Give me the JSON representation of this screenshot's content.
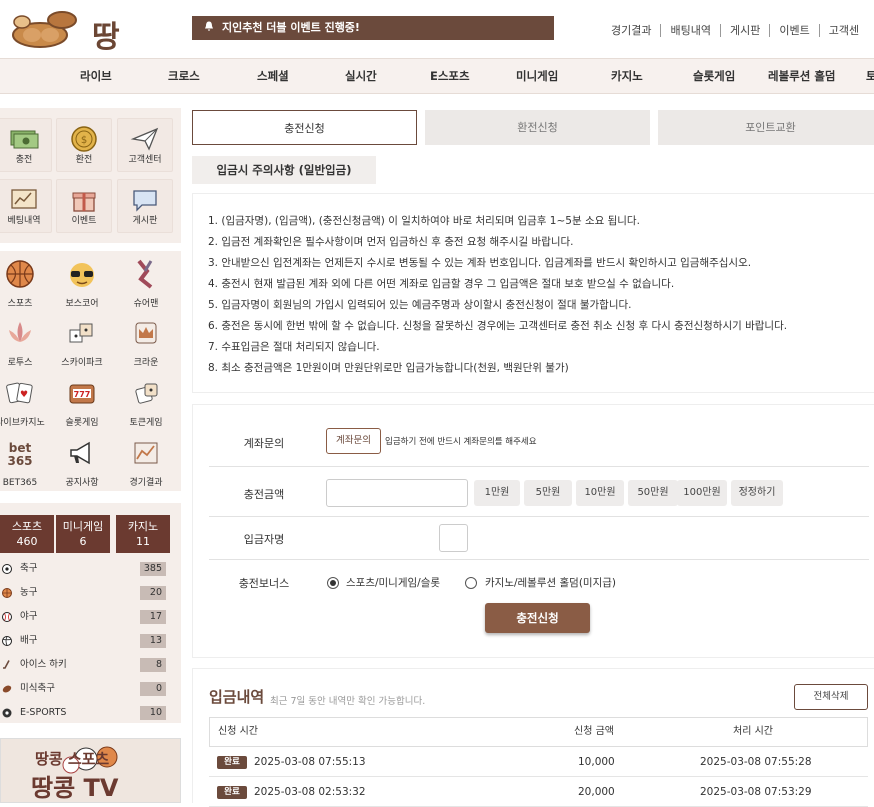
{
  "brand": {
    "name": "땅콩"
  },
  "notice": {
    "text": "지인추천 더블 이벤트 진행중!"
  },
  "top_links": [
    "경기결과",
    "배팅내역",
    "게시판",
    "이벤트",
    "고객센"
  ],
  "nav": [
    "라이브",
    "크로스",
    "스페셜",
    "실시간",
    "E스포츠",
    "미니게임",
    "카지노",
    "슬롯게임",
    "레볼루션 홀덤",
    "토"
  ],
  "sidebar": {
    "quick": [
      "충전",
      "환전",
      "고객센터",
      "베팅내역",
      "이벤트",
      "게시판"
    ],
    "games": [
      "스포츠",
      "보스코어",
      "슈어맨",
      "로투스",
      "스카이파크",
      "크라운",
      "라이브카지노",
      "슬롯게임",
      "토큰게임",
      "BET365",
      "공지사항",
      "경기결과"
    ],
    "counts": [
      {
        "label": "스포츠",
        "value": "460"
      },
      {
        "label": "미니게임",
        "value": "6"
      },
      {
        "label": "카지노",
        "value": "11"
      }
    ],
    "sports": [
      {
        "name": "축구",
        "count": "385"
      },
      {
        "name": "농구",
        "count": "20"
      },
      {
        "name": "야구",
        "count": "17"
      },
      {
        "name": "배구",
        "count": "13"
      },
      {
        "name": "아이스 하키",
        "count": "8"
      },
      {
        "name": "미식축구",
        "count": "0"
      },
      {
        "name": "E-SPORTS",
        "count": "10"
      }
    ],
    "banner": {
      "line1": "땅콩 스포츠",
      "line2": "땅콩 TV"
    }
  },
  "tabs": [
    "충전신청",
    "환전신청",
    "포인트교환"
  ],
  "subhead": "입금시 주의사항 (일반입금)",
  "rules": [
    "1. (입금자명), (입금액), (충전신청금액) 이 일치하여야 바로 처리되며 입금후 1~5분 소요 됩니다.",
    "2. 입금전 계좌확인은 필수사항이며 먼저 입금하신 후 충전 요청 해주시길 바랍니다.",
    "3. 안내받으신 입전계좌는 언제든지 수시로 변동될 수 있는 계좌 번호입니다. 입금계좌를 반드시 확인하시고 입금해주십시오.",
    "4. 충전시 현재 발급된 계좌 외에 다른 어떤 계좌로 입금할 경우 그 입금액은 절대 보호 받으실 수 없습니다.",
    "5. 입금자명이 회원님의 가입시 입력되어 있는 예금주명과 상이할시 충전신청이 절대 불가합니다.",
    "6. 충전은 동시에 한번 밖에 할 수 없습니다. 신청을 잘못하신 경우에는 고객센터로 충전 취소 신청 후 다시 충전신청하시기 바랍니다.",
    "7. 수표입금은 절대 처리되지 않습니다.",
    "8. 최소 충전금액은 1만원이며 만원단위로만 입금가능합니다(천원, 백원단위 불가)"
  ],
  "form": {
    "account_label": "계좌문의",
    "account_button": "계좌문의",
    "account_note": "입금하기 전에 반드시 계좌문의를 해주세요",
    "amount_label": "충전금액",
    "amount_buttons": [
      "1만원",
      "5만원",
      "10만원",
      "50만원",
      "100만원",
      "정정하기"
    ],
    "depositor_label": "입금자명",
    "bonus_label": "충전보너스",
    "bonus_options": [
      "스포츠/미니게임/슬롯",
      "카지노/레볼루션 홀덤(미지급)"
    ],
    "bonus_selected": 0,
    "submit": "충전신청"
  },
  "history": {
    "title": "입금내역",
    "subtitle": "최근 7일 동안 내역만 확인 가능합니다.",
    "delete_all": "전체삭제",
    "columns": [
      "신청 시간",
      "신청 금액",
      "처리 시간"
    ],
    "rows": [
      {
        "status": "완료",
        "requested": "2025-03-08 07:55:13",
        "amount": "10,000",
        "processed": "2025-03-08 07:55:28"
      },
      {
        "status": "완료",
        "requested": "2025-03-08 02:53:32",
        "amount": "20,000",
        "processed": "2025-03-08 07:53:29"
      }
    ]
  },
  "colors": {
    "brand": "#6b4a3c",
    "button": "#8a5c45",
    "count_tab": "#6b3a30"
  }
}
